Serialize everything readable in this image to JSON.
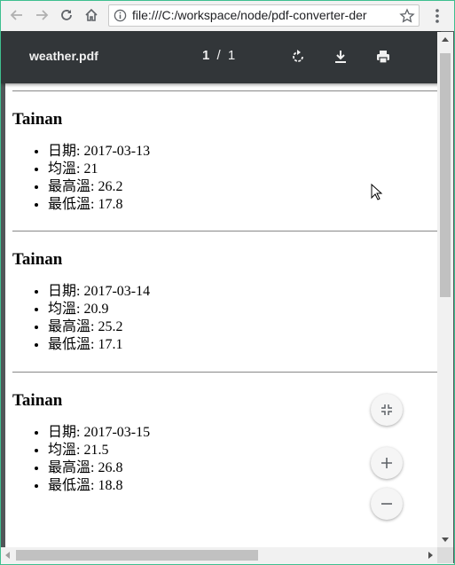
{
  "browser": {
    "url": "file:///C:/workspace/node/pdf-converter-der",
    "icons": [
      "back-arrow-icon",
      "forward-arrow-icon",
      "reload-icon",
      "home-icon",
      "info-icon",
      "star-icon",
      "menu-dots-icon"
    ]
  },
  "viewer": {
    "file_name": "weather.pdf",
    "page_current": "1",
    "page_separator": "/",
    "page_total": "1",
    "toolbar_icons": [
      "rotate-icon",
      "download-icon",
      "print-icon"
    ],
    "fab_icons": [
      "fit-page-icon",
      "zoom-in-icon",
      "zoom-out-icon"
    ],
    "toolbar_color": "#323639",
    "background_color": "#525659"
  },
  "sections": [
    {
      "city": "Tainan",
      "items": [
        "日期: 2017-03-13",
        "均溫: 21",
        "最高溫: 26.2",
        "最低溫: 17.8"
      ]
    },
    {
      "city": "Tainan",
      "items": [
        "日期: 2017-03-14",
        "均溫: 20.9",
        "最高溫: 25.2",
        "最低溫: 17.1"
      ]
    },
    {
      "city": "Tainan",
      "items": [
        "日期: 2017-03-15",
        "均溫: 21.5",
        "最高溫: 26.8",
        "最低溫: 18.8"
      ]
    }
  ]
}
